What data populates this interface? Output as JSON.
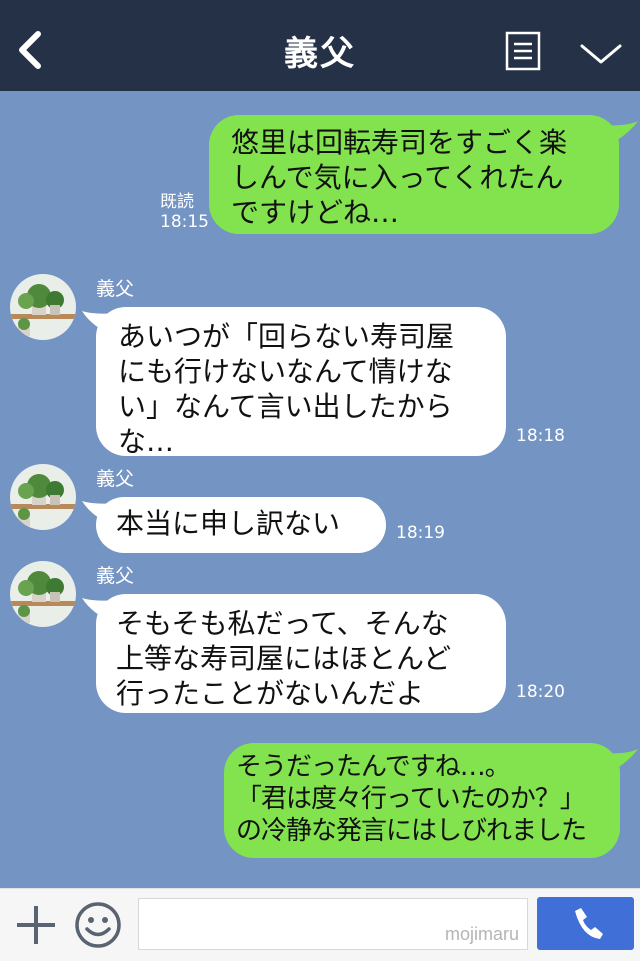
{
  "header": {
    "title": "義父",
    "back_icon": "chevron-left-icon",
    "menu_icon": "document-menu-icon",
    "dropdown_icon": "chevron-down-icon"
  },
  "colors": {
    "header_bg": "#253146",
    "chat_bg": "#7494c3",
    "sent_bubble": "#83e34f",
    "received_bubble": "#ffffff",
    "send_button": "#3f6fd7"
  },
  "messages": [
    {
      "side": "sent",
      "text": "悠里は回転寿司をすごく楽\nしんで気に入ってくれたん\nですけどね…",
      "read": "既読",
      "time": "18:15"
    },
    {
      "side": "received",
      "sender": "義父",
      "text": "あいつが「回らない寿司屋\nにも行けないなんて情けな\nい」なんて言い出したから\nな…",
      "time": "18:18"
    },
    {
      "side": "received",
      "sender": "義父",
      "text": "本当に申し訳ない",
      "time": "18:19"
    },
    {
      "side": "received",
      "sender": "義父",
      "text": "そもそも私だって、そんな\n上等な寿司屋にはほとんど\n行ったことがないんだよ",
      "time": "18:20"
    },
    {
      "side": "sent",
      "text": "そうだったんですね…。\n「君は度々行っていたのか？」\nの冷静な発言にはしびれました"
    }
  ],
  "input": {
    "placeholder": "",
    "watermark": "mojimaru",
    "plus_icon": "plus-icon",
    "sticker_icon": "smiley-icon",
    "send_icon": "phone-icon"
  }
}
